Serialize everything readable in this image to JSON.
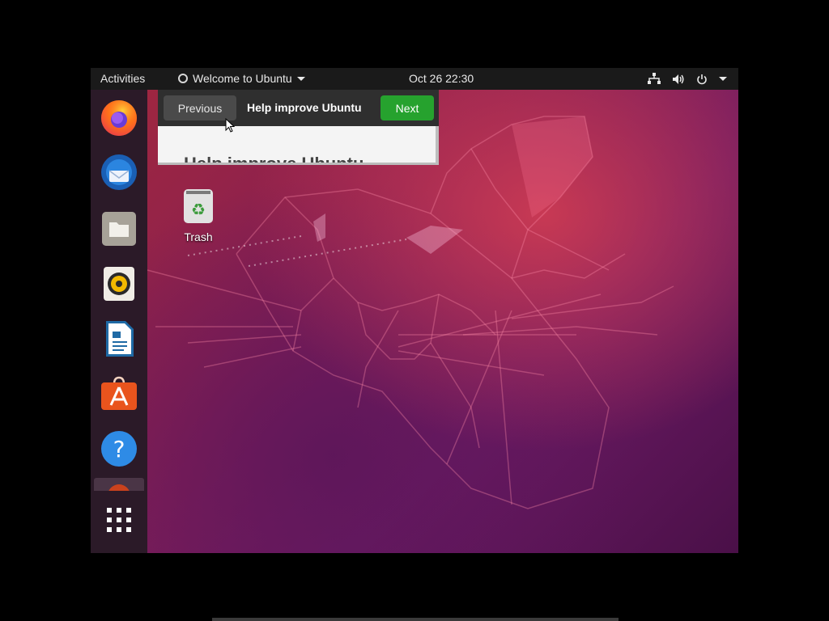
{
  "topbar": {
    "activities": "Activities",
    "app_menu_label": "Welcome to Ubuntu",
    "clock": "Oct 26  22:30",
    "tray_icons": [
      "network-icon",
      "volume-icon",
      "power-icon",
      "chevron-down-icon"
    ]
  },
  "dock": {
    "items": [
      {
        "name": "Firefox",
        "icon": "firefox-icon"
      },
      {
        "name": "Thunderbird Mail",
        "icon": "thunderbird-icon"
      },
      {
        "name": "Files",
        "icon": "files-icon"
      },
      {
        "name": "Rhythmbox",
        "icon": "rhythmbox-icon"
      },
      {
        "name": "LibreOffice Writer",
        "icon": "writer-icon"
      },
      {
        "name": "Ubuntu Software",
        "icon": "software-icon"
      },
      {
        "name": "Help",
        "icon": "help-icon"
      },
      {
        "name": "Show Applications",
        "icon": "app-grid-icon"
      }
    ]
  },
  "welcome": {
    "previous_label": "Previous",
    "title": "Help improve Ubuntu",
    "next_label": "Next",
    "heading": "Help improve Ubuntu"
  },
  "desktop": {
    "trash_label": "Trash"
  },
  "colors": {
    "topbar": "#1a1a1a",
    "dock": "#2b1a28",
    "next_button": "#26a22e",
    "previous_button": "#4a4a4a"
  }
}
